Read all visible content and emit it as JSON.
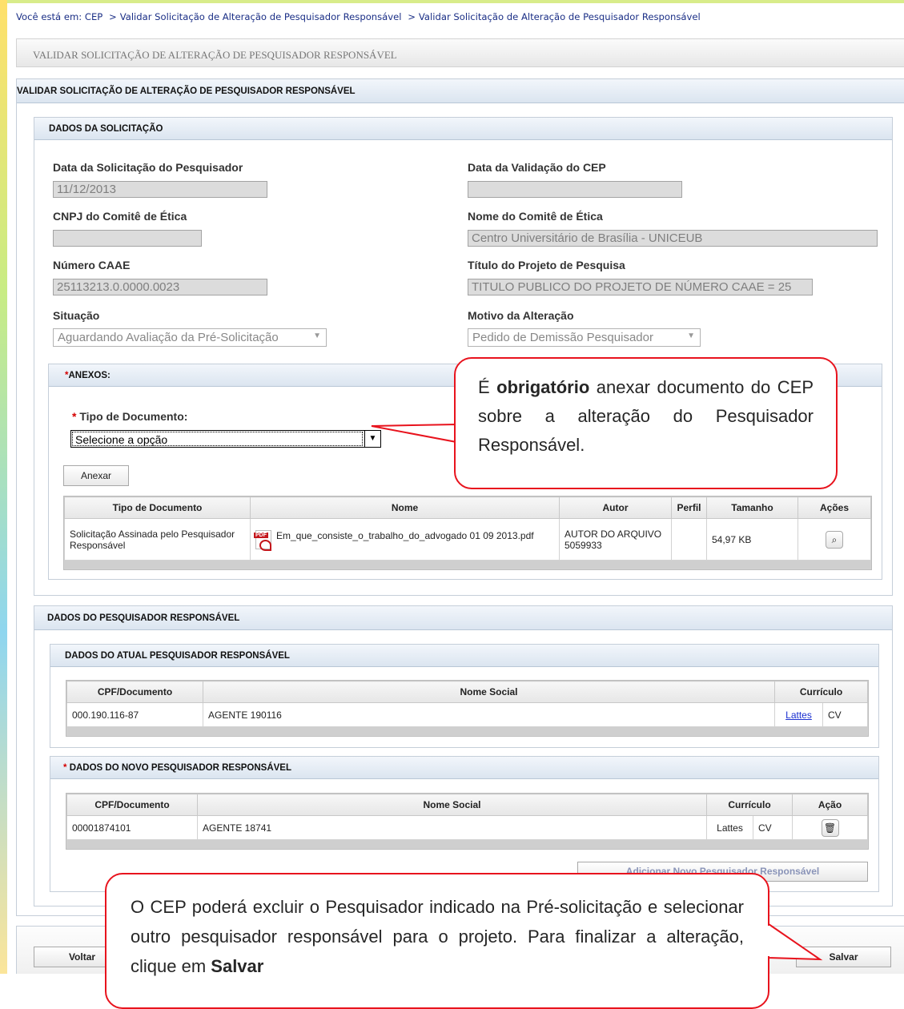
{
  "breadcrumb": {
    "prefix": "Você está em:",
    "items": [
      "CEP",
      "Validar Solicitação de Alteração de Pesquisador Responsável",
      "Validar Solicitação de Alteração de Pesquisador Responsável"
    ],
    "separator": ">"
  },
  "page_title": "VALIDAR SOLICITAÇÃO DE ALTERAÇÃO DE PESQUISADOR RESPONSÁVEL",
  "main_panel_title": "VALIDAR SOLICITAÇÃO DE ALTERAÇÃO DE PESQUISADOR RESPONSÁVEL",
  "dados_solicitacao": {
    "title": "DADOS DA SOLICITAÇÃO",
    "data_solicitacao_label": "Data da Solicitação do Pesquisador",
    "data_solicitacao_value": "11/12/2013",
    "data_validacao_label": "Data da Validação do CEP",
    "data_validacao_value": "",
    "cnpj_label": "CNPJ do Comitê de Ética",
    "cnpj_value": "",
    "nome_comite_label": "Nome do Comitê de Ética",
    "nome_comite_value": "Centro Universitário de Brasília - UNICEUB",
    "caae_label": "Número CAAE",
    "caae_value": "25113213.0.0000.0023",
    "titulo_label": "Título do Projeto de Pesquisa",
    "titulo_value": "TITULO PUBLICO DO PROJETO DE NÚMERO CAAE = 25",
    "situacao_label": "Situação",
    "situacao_value": "Aguardando Avaliação da Pré-Solicitação",
    "motivo_label": "Motivo da Alteração",
    "motivo_value": "Pedido de Demissão Pesquisador"
  },
  "anexos": {
    "required_mark": "*",
    "title": "ANEXOS:",
    "tipo_label": "Tipo de Documento:",
    "tipo_value": "Selecione a opção",
    "anexar_button": "Anexar",
    "columns": [
      "Tipo de Documento",
      "Nome",
      "Autor",
      "Perfil",
      "Tamanho",
      "Ações"
    ],
    "rows": [
      {
        "tipo": "Solicitação Assinada pelo Pesquisador Responsável",
        "nome": "Em_que_consiste_o_trabalho_do_advogado 01 09 2013.pdf",
        "autor": "AUTOR DO ARQUIVO 5059933",
        "perfil": "",
        "tamanho": "54,97 KB",
        "acao_icon": "magnifier-icon"
      }
    ]
  },
  "pesquisador": {
    "title": "DADOS DO PESQUISADOR RESPONSÁVEL",
    "atual": {
      "title": "DADOS DO ATUAL PESQUISADOR RESPONSÁVEL",
      "columns": [
        "CPF/Documento",
        "Nome Social",
        "Currículo"
      ],
      "rows": [
        {
          "cpf": "000.190.116-87",
          "nome": "AGENTE 190116",
          "lattes": "Lattes",
          "cv": "CV"
        }
      ]
    },
    "novo": {
      "required_mark": "*",
      "title": "DADOS DO NOVO PESQUISADOR RESPONSÁVEL",
      "columns": [
        "CPF/Documento",
        "Nome Social",
        "Currículo",
        "Ação"
      ],
      "rows": [
        {
          "cpf": "00001874101",
          "nome": "AGENTE 18741",
          "lattes": "Lattes",
          "cv": "CV",
          "acao_icon": "trash-icon"
        }
      ],
      "add_button_partial": "Adicionar Novo Pesquisador Responsável"
    }
  },
  "footer": {
    "voltar": "Voltar",
    "salvar": "Salvar"
  },
  "callouts": {
    "anexo": {
      "prefix": "É ",
      "bold": "obrigatório",
      "suffix": " anexar documento do CEP sobre a alteração do Pesquisador Responsável."
    },
    "excluir": {
      "text": "O CEP poderá excluir o Pesquisador indicado na Pré-solicitação e selecionar outro pesquisador responsável para o projeto. Para finalizar a alteração, clique em ",
      "bold": "Salvar"
    }
  },
  "colors": {
    "callout_border": "#e8131d",
    "link": "#1a2fd0",
    "breadcrumb": "#1b2f86",
    "required": "#d40000"
  }
}
